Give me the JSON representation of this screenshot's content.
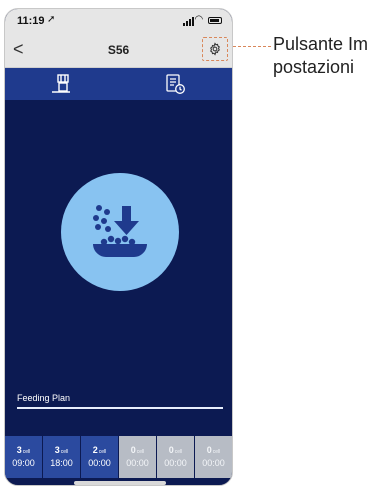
{
  "status_bar": {
    "time": "11:19",
    "location_icon": "location-arrow-icon"
  },
  "navbar": {
    "back_label": "<",
    "title": "S56",
    "settings_icon": "gear-icon"
  },
  "tabs": [
    {
      "icon": "feeder-icon"
    },
    {
      "icon": "schedule-document-icon"
    }
  ],
  "main": {
    "icon": "food-dispense-icon",
    "circle_color": "#88c3f1"
  },
  "feeding_plan": {
    "label": "Feeding Plan",
    "slots": [
      {
        "count": "3",
        "unit": "cell",
        "time": "09:00",
        "active": true
      },
      {
        "count": "3",
        "unit": "cell",
        "time": "18:00",
        "active": true
      },
      {
        "count": "2",
        "unit": "cell",
        "time": "00:00",
        "active": true
      },
      {
        "count": "0",
        "unit": "cell",
        "time": "00:00",
        "active": false
      },
      {
        "count": "0",
        "unit": "cell",
        "time": "00:00",
        "active": false
      },
      {
        "count": "0",
        "unit": "cell",
        "time": "00:00",
        "active": false
      }
    ]
  },
  "callout": {
    "text": "Pulsante Impostazioni"
  },
  "colors": {
    "background": "#0c1a52",
    "tabbar": "#1f3a8d",
    "accent": "#d9875a",
    "inactive_cell": "#b7bcc5",
    "active_cell": "#2b4a9f"
  }
}
